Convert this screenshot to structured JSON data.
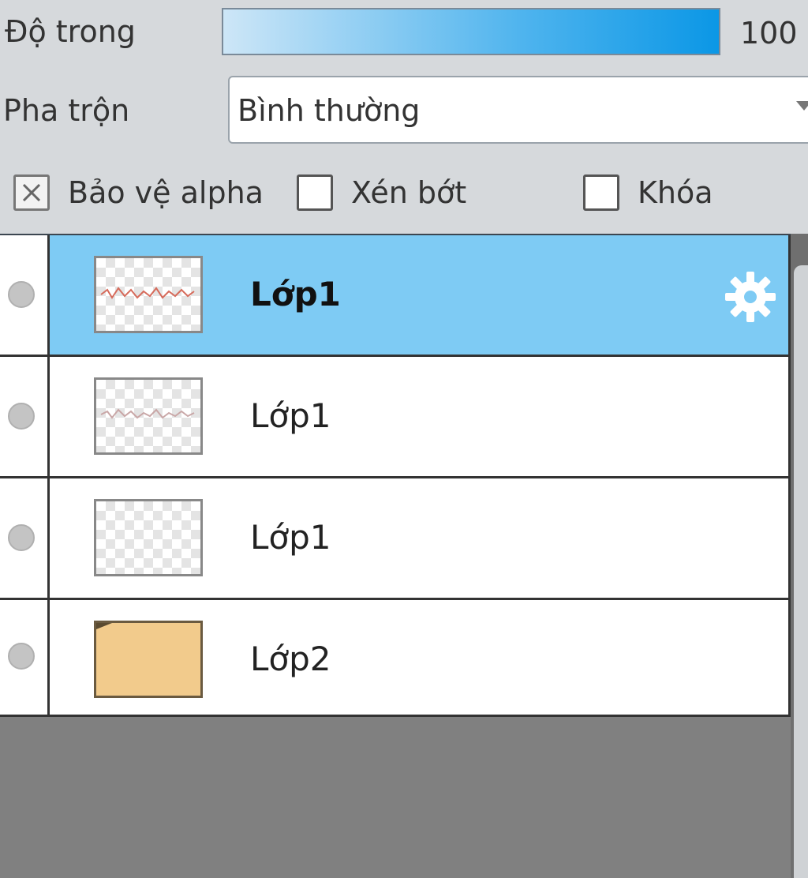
{
  "opacity": {
    "label": "Độ trong",
    "value_text": "100 %",
    "level": 1.0
  },
  "blend": {
    "label": "Pha trộn",
    "selected": "Bình thường"
  },
  "options": {
    "protect_alpha": {
      "label": "Bảo vệ alpha",
      "checked": true
    },
    "clip": {
      "label": "Xén bớt",
      "checked": false
    },
    "lock": {
      "label": "Khóa",
      "checked": false
    }
  },
  "layers": [
    {
      "name": "Lớp1",
      "selected": true,
      "thumbnail": "red-sketch"
    },
    {
      "name": "Lớp1",
      "selected": false,
      "thumbnail": "faint-sketch"
    },
    {
      "name": "Lớp1",
      "selected": false,
      "thumbnail": "transparent"
    },
    {
      "name": "Lớp2",
      "selected": false,
      "thumbnail": "tan-fill"
    }
  ],
  "colors": {
    "selected_row": "#7ecbf4",
    "opacity_fill": "#0b97e6",
    "layer2_fill": "#f2cb8c"
  },
  "icons": {
    "layer_settings": "gear-icon",
    "visibility": "visibility-dot-icon"
  }
}
